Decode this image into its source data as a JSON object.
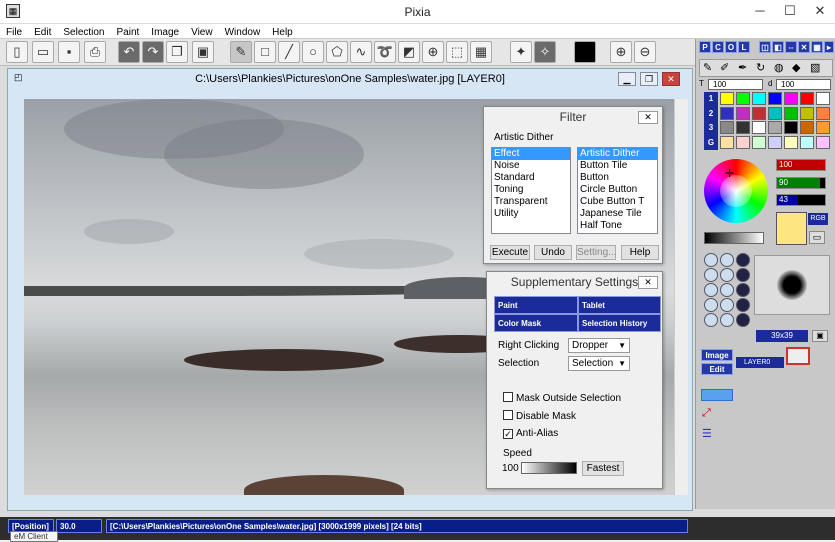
{
  "app": {
    "title": "Pixia",
    "icon": "pixia-icon"
  },
  "menu": [
    "File",
    "Edit",
    "Selection",
    "Paint",
    "Image",
    "View",
    "Window",
    "Help"
  ],
  "doc": {
    "title": "C:\\Users\\Plankies\\Pictures\\onOne Samples\\water.jpg [LAYER0]"
  },
  "filter": {
    "title": "Filter",
    "category": "Artistic Dither",
    "left_items": [
      "Effect",
      "Noise",
      "Standard",
      "Toning",
      "Transparent",
      "Utility"
    ],
    "left_selected": "Effect",
    "right_items": [
      "Artistic Dither",
      "Button Tile",
      "Button",
      "Circle Button",
      "Cube Button T",
      "Japanese Tile",
      "Half Tone"
    ],
    "right_selected": "Artistic Dither",
    "buttons": {
      "execute": "Execute",
      "undo": "Undo",
      "setting": "Setting...",
      "help": "Help"
    }
  },
  "supp": {
    "title": "Supplementary Settings",
    "tabs": [
      "Paint",
      "Tablet",
      "Color Mask",
      "Selection History"
    ],
    "right_click_label": "Right Clicking",
    "right_click_value": "Dropper",
    "selection_label": "Selection",
    "selection_value": "Selection",
    "mask_outside": "Mask Outside Selection",
    "disable_mask": "Disable Mask",
    "anti_alias": "Anti-Alias",
    "anti_alias_checked": true,
    "speed_label": "Speed",
    "speed_value": "100",
    "speed_button": "Fastest"
  },
  "palette": {
    "tabs": [
      "P",
      "C",
      "O",
      "L"
    ],
    "val1": "100",
    "val_d": "100",
    "rows": [
      "1",
      "2",
      "3",
      "G"
    ],
    "r": "100",
    "g": "90",
    "b": "43",
    "rgb_label": "RGB",
    "brush_size": "39x39",
    "image_btn": "Image",
    "edit_btn": "Edit",
    "layer": "LAYER0",
    "t_label": "T",
    "d_label": "d"
  },
  "status": {
    "position": "[Position]",
    "zoom": "30.0",
    "info": "[C:\\Users\\Plankies\\Pictures\\onOne Samples\\water.jpg] [3000x1999 pixels] [24 bits]",
    "tooltip": "eM Client"
  },
  "colors": {
    "accent": "#1c2b9a",
    "selection": "#3399ff",
    "fg": "#000000",
    "bg_swatch": "#fde681"
  }
}
